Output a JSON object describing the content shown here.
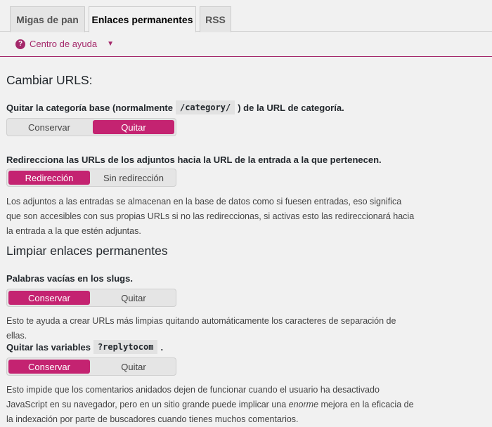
{
  "tabs": [
    {
      "label": "Migas de pan",
      "active": false
    },
    {
      "label": "Enlaces permanentes",
      "active": true
    },
    {
      "label": "RSS",
      "active": false
    }
  ],
  "help": {
    "icon": "help-icon",
    "label": "Centro de ayuda",
    "caret": "▼"
  },
  "sections": {
    "urls": {
      "title": "Cambiar URLS:",
      "category": {
        "label_pre": "Quitar la categoría base (normalmente",
        "code": "/category/",
        "label_post": ") de la URL de categoría.",
        "options": [
          "Conservar",
          "Quitar"
        ],
        "selected": "Quitar"
      },
      "attachments": {
        "label": "Redirecciona las URLs de los adjuntos hacia la URL de la entrada a la que pertenecen.",
        "options": [
          "Redirección",
          "Sin redirección"
        ],
        "selected": "Redirección",
        "description": "Los adjuntos a las entradas se almacenan en la base de datos como si fuesen entradas, eso significa que son accesibles con sus propias URLs si no las redireccionas, si activas esto las redireccionará hacia la entrada a la que estén adjuntas."
      }
    },
    "clean": {
      "title": "Limpiar enlaces permanentes",
      "stopwords": {
        "label": "Palabras vacías en los slugs.",
        "options": [
          "Conservar",
          "Quitar"
        ],
        "selected": "Conservar",
        "description": "Esto te ayuda a crear URLs más limpias quitando automáticamente los caracteres de separación de ellas."
      },
      "replytocom": {
        "label_pre": "Quitar las variables",
        "code": "?replytocom",
        "label_post": ".",
        "options": [
          "Conservar",
          "Quitar"
        ],
        "selected": "Conservar",
        "description_pre": "Esto impide que los comentarios anidados dejen de funcionar cuando el usuario ha desactivado JavaScript en su navegador, pero en un sitio grande puede implicar una ",
        "description_em": "enorme",
        "description_post": " mejora en la eficacia de la indexación por parte de buscadores cuando tienes muchos comentarios."
      }
    }
  },
  "colors": {
    "accent": "#c42371",
    "help": "#a4286a"
  }
}
